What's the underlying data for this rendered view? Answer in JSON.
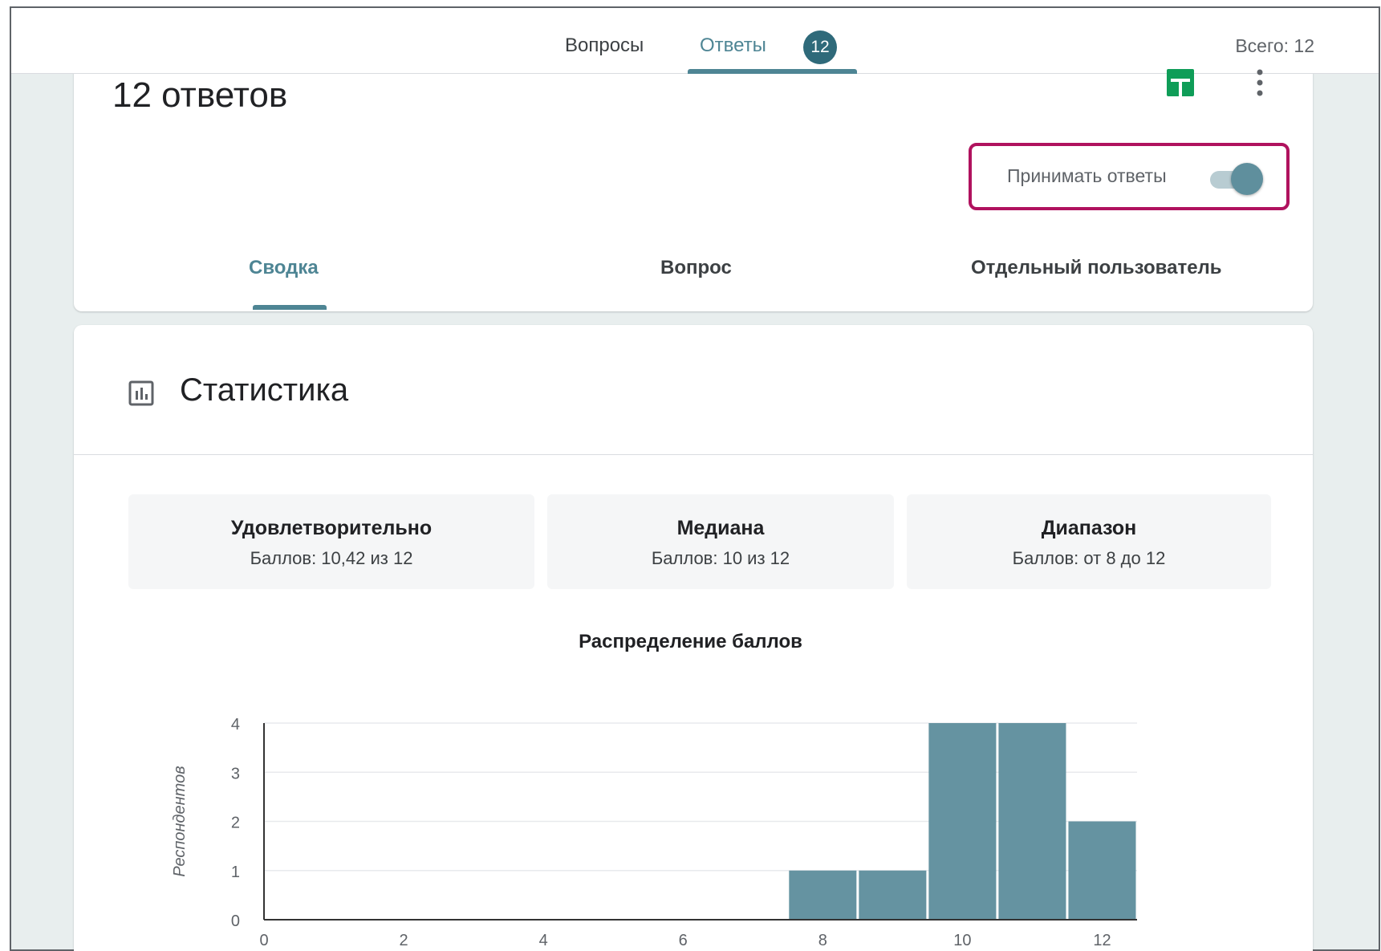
{
  "header": {
    "tabs": [
      "Вопросы",
      "Ответы"
    ],
    "responses_badge": "12",
    "total": "Всего: 12"
  },
  "summary_card": {
    "title": "12 ответов",
    "accept_label": "Принимать ответы",
    "accept_on": true,
    "subtabs": [
      "Сводка",
      "Вопрос",
      "Отдельный пользователь"
    ],
    "active_subtab": "Сводка"
  },
  "stats": {
    "title": "Статистика",
    "metrics": [
      {
        "title": "Удовлетворительно",
        "value": "Баллов: 10,42 из 12"
      },
      {
        "title": "Медиана",
        "value": "Баллов: 10 из 12"
      },
      {
        "title": "Диапазон",
        "value": "Баллов: от 8 до 12"
      }
    ]
  },
  "colors": {
    "accent": "#4e8594",
    "bar": "#6593a1",
    "highlight_border": "#b0125e",
    "sheets_green": "#0f9d58"
  },
  "chart_data": {
    "type": "bar",
    "title": "Распределение баллов",
    "xlabel": "",
    "ylabel": "Респондентов",
    "x_ticks": [
      "0",
      "2",
      "4",
      "6",
      "8",
      "10",
      "12"
    ],
    "y_ticks": [
      "0",
      "1",
      "2",
      "3",
      "4"
    ],
    "categories": [
      8,
      9,
      10,
      11,
      12
    ],
    "values": [
      1,
      1,
      4,
      4,
      2
    ],
    "xlim": [
      0,
      12.5
    ],
    "ylim": [
      0,
      4
    ],
    "grid": true
  }
}
